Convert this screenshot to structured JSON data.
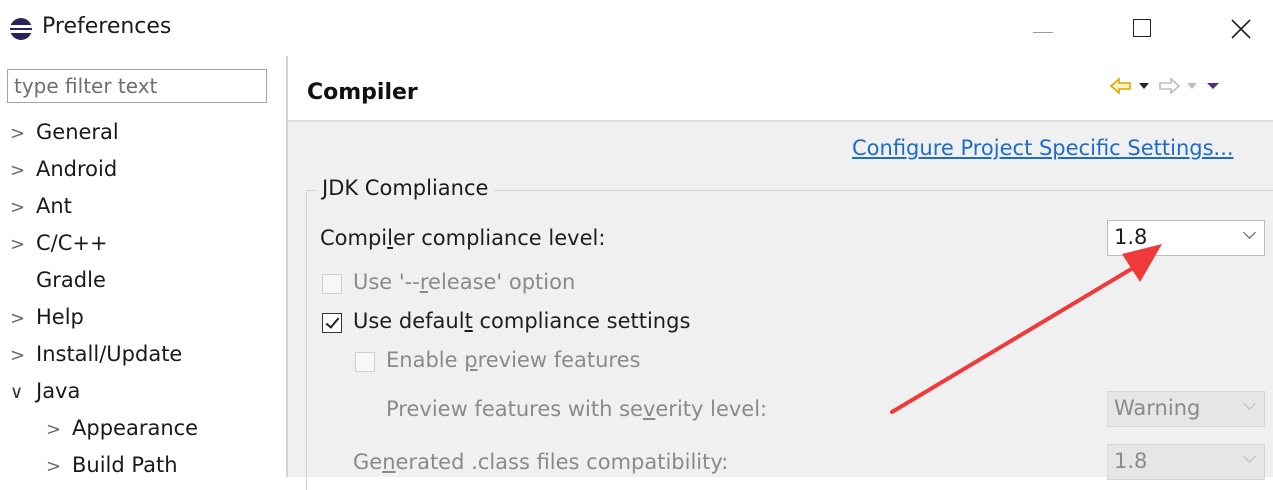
{
  "window": {
    "title": "Preferences",
    "icon": "eclipse-icon",
    "controls": [
      "minimize-icon",
      "maximize-icon",
      "close-icon"
    ]
  },
  "sidebar": {
    "filter_placeholder": "type filter text",
    "items": [
      {
        "label": "General",
        "expanded": false,
        "depth": 0
      },
      {
        "label": "Android",
        "expanded": false,
        "depth": 0
      },
      {
        "label": "Ant",
        "expanded": false,
        "depth": 0
      },
      {
        "label": "C/C++",
        "expanded": false,
        "depth": 0
      },
      {
        "label": "Gradle",
        "expanded": false,
        "depth": 0,
        "leaf": true
      },
      {
        "label": "Help",
        "expanded": false,
        "depth": 0
      },
      {
        "label": "Install/Update",
        "expanded": false,
        "depth": 0
      },
      {
        "label": "Java",
        "expanded": true,
        "depth": 0
      },
      {
        "label": "Appearance",
        "expanded": false,
        "depth": 1
      },
      {
        "label": "Build Path",
        "expanded": false,
        "depth": 1
      }
    ]
  },
  "page": {
    "title": "Compiler",
    "configure_link": "Configure Project Specific Settings...",
    "nav_icons": [
      "back-arrow-icon",
      "back-dropdown-icon",
      "forward-arrow-icon",
      "forward-dropdown-icon",
      "view-menu-icon"
    ]
  },
  "jdk": {
    "group_label": "JDK Compliance",
    "compliance": {
      "pre": "Compi",
      "u": "l",
      "post": "er compliance level:",
      "value": "1.8"
    },
    "release": {
      "pre": "Use '--",
      "u": "r",
      "post": "elease' option",
      "checked": false,
      "enabled": false
    },
    "default_settings": {
      "pre": "Use defaul",
      "u": "t",
      "post": " compliance settings",
      "checked": true,
      "enabled": true
    },
    "preview": {
      "pre": "Enable ",
      "u": "p",
      "post": "review features",
      "checked": false,
      "enabled": false
    },
    "severity": {
      "pre": "Preview features with se",
      "u": "v",
      "post": "erity level:",
      "value": "Warning",
      "enabled": false
    },
    "class_compat": {
      "pre": "Ge",
      "u": "n",
      "post": "erated .class files compatibility:",
      "value": "1.8",
      "enabled": false
    }
  },
  "colors": {
    "link": "#1e6cc8",
    "annotation_arrow": "#f03a3a",
    "nav_arrow": "#e0a800"
  }
}
